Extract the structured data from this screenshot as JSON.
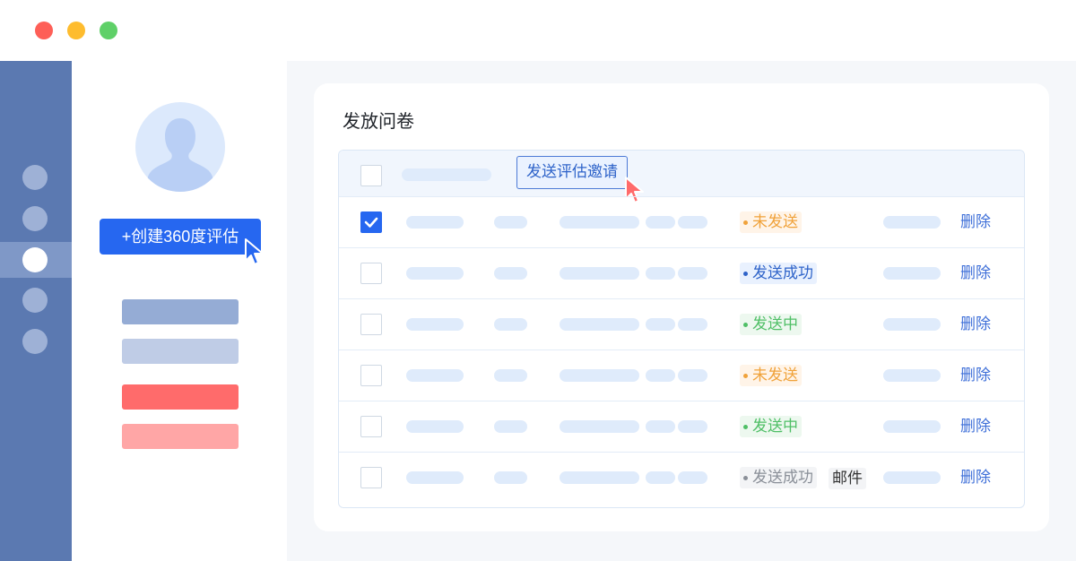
{
  "window": {
    "controls": [
      "close",
      "minimize",
      "maximize"
    ],
    "colors": {
      "close": "#fe5f57",
      "minimize": "#febc2e",
      "maximize": "#5fd068"
    }
  },
  "sidebar": {
    "items": [
      "nav-1",
      "nav-2",
      "nav-3",
      "nav-4",
      "nav-5"
    ],
    "active_index": 2
  },
  "profile": {
    "avatar_icon": "user-silhouette-icon",
    "create_button": "+创建360度评估"
  },
  "card": {
    "title": "发放问卷",
    "send_invite_button": "发送评估邀请"
  },
  "table": {
    "rows": [
      {
        "checked": true,
        "status": "未发送",
        "status_color": "#f0a23a",
        "status_bg": "#fff4e8",
        "extra_tag": "",
        "action": "删除"
      },
      {
        "checked": false,
        "status": "发送成功",
        "status_color": "#2e63c9",
        "status_bg": "#e9f1fe",
        "extra_tag": "",
        "action": "删除"
      },
      {
        "checked": false,
        "status": "发送中",
        "status_color": "#4fbf66",
        "status_bg": "#edf8ef",
        "extra_tag": "",
        "action": "删除"
      },
      {
        "checked": false,
        "status": "未发送",
        "status_color": "#f0a23a",
        "status_bg": "#fff4e8",
        "extra_tag": "",
        "action": "删除"
      },
      {
        "checked": false,
        "status": "发送中",
        "status_color": "#4fbf66",
        "status_bg": "#edf8ef",
        "extra_tag": "",
        "action": "删除"
      },
      {
        "checked": false,
        "status": "发送成功",
        "status_color": "#8a8f98",
        "status_bg": "#f3f4f6",
        "extra_tag": "邮件",
        "action": "删除"
      }
    ]
  },
  "colors": {
    "accent": "#2667f0",
    "rail": "#5b79b1",
    "danger": "#ff6b6b"
  }
}
